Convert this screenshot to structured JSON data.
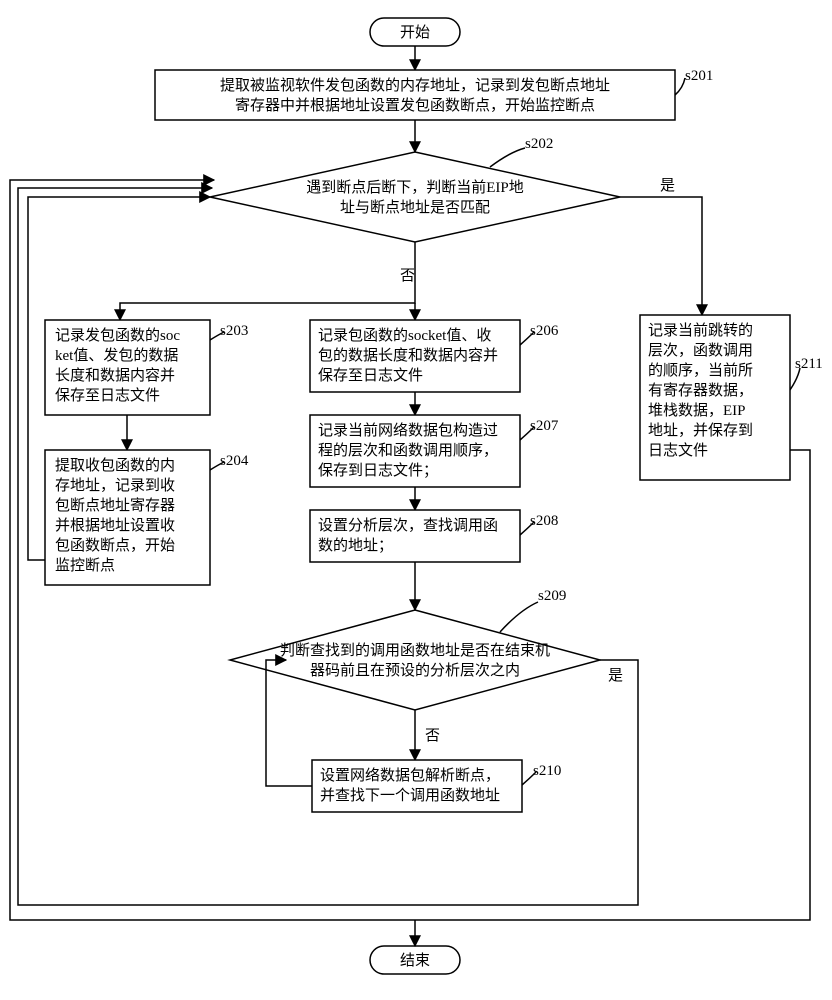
{
  "chart_data": {
    "type": "flowchart",
    "title": "",
    "nodes": [
      {
        "id": "start",
        "type": "terminator",
        "text": "开始"
      },
      {
        "id": "s201",
        "type": "process",
        "label": "s201",
        "text": "提取被监视软件发包函数的内存地址，记录到发包断点地址寄存器中并根据地址设置发包函数断点，开始监控断点"
      },
      {
        "id": "s202",
        "type": "decision",
        "label": "s202",
        "text": "遇到断点后断下，判断当前EIP地址与断点地址是否匹配"
      },
      {
        "id": "s203",
        "type": "process",
        "label": "s203",
        "text": "记录发包函数的socket值、发包的数据长度和数据内容并保存至日志文件"
      },
      {
        "id": "s204",
        "type": "process",
        "label": "s204",
        "text": "提取收包函数的内存地址，记录到收包断点地址寄存器并根据地址设置收包函数断点，开始监控断点"
      },
      {
        "id": "s206",
        "type": "process",
        "label": "s206",
        "text": "记录包函数的socket值、收包的数据长度和数据内容并保存至日志文件"
      },
      {
        "id": "s207",
        "type": "process",
        "label": "s207",
        "text": "记录当前网络数据包构造过程的层次和函数调用顺序，保存到日志文件；"
      },
      {
        "id": "s208",
        "type": "process",
        "label": "s208",
        "text": "设置分析层次，查找调用函数的地址；"
      },
      {
        "id": "s209",
        "type": "decision",
        "label": "s209",
        "text": "判断查找到的调用函数地址是否在结束机器码前且在预设的分析层次之内"
      },
      {
        "id": "s210",
        "type": "process",
        "label": "s210",
        "text": "设置网络数据包解析断点，并查找下一个调用函数地址"
      },
      {
        "id": "s211",
        "type": "process",
        "label": "s211",
        "text": "记录当前跳转的层次，函数调用的顺序，当前所有寄存器数据，堆栈数据，EIP地址，并保存到日志文件"
      },
      {
        "id": "end",
        "type": "terminator",
        "text": "结束"
      }
    ],
    "edges": [
      {
        "from": "start",
        "to": "s201",
        "label": ""
      },
      {
        "from": "s201",
        "to": "s202",
        "label": ""
      },
      {
        "from": "s202",
        "to": "s203",
        "label": "否(left)"
      },
      {
        "from": "s202",
        "to": "s206",
        "label": "否(down)"
      },
      {
        "from": "s202",
        "to": "s211",
        "label": "是"
      },
      {
        "from": "s203",
        "to": "s204",
        "label": ""
      },
      {
        "from": "s204",
        "to": "s202",
        "label": "loop"
      },
      {
        "from": "s206",
        "to": "s207",
        "label": ""
      },
      {
        "from": "s207",
        "to": "s208",
        "label": ""
      },
      {
        "from": "s208",
        "to": "s209",
        "label": ""
      },
      {
        "from": "s209",
        "to": "s210",
        "label": "否"
      },
      {
        "from": "s210",
        "to": "s209",
        "label": "loop"
      },
      {
        "from": "s209",
        "to": "s202",
        "label": "是(loop)"
      },
      {
        "from": "s211",
        "to": "s202",
        "label": "loop"
      },
      {
        "from": "flow",
        "to": "end",
        "label": ""
      }
    ]
  },
  "terminators": {
    "start": "开始",
    "end": "结束"
  },
  "labels": {
    "s201": "s201",
    "s202": "s202",
    "s203": "s203",
    "s204": "s204",
    "s206": "s206",
    "s207": "s207",
    "s208": "s208",
    "s209": "s209",
    "s210": "s210",
    "s211": "s211"
  },
  "edge_labels": {
    "yes": "是",
    "no": "否"
  },
  "s201": {
    "l1": "提取被监视软件发包函数的内存地址，记录到发包断点地址",
    "l2": "寄存器中并根据地址设置发包函数断点，开始监控断点"
  },
  "s202": {
    "l1": "遇到断点后断下，判断当前EIP地",
    "l2": "址与断点地址是否匹配"
  },
  "s203": {
    "l1": "记录发包函数的soc",
    "l2": "ket值、发包的数据",
    "l3": "长度和数据内容并",
    "l4": "保存至日志文件"
  },
  "s204": {
    "l1": "提取收包函数的内",
    "l2": "存地址，记录到收",
    "l3": "包断点地址寄存器",
    "l4": "并根据地址设置收",
    "l5": "包函数断点，开始",
    "l6": "监控断点"
  },
  "s206": {
    "l1": "记录包函数的socket值、收",
    "l2": "包的数据长度和数据内容并",
    "l3": "保存至日志文件"
  },
  "s207": {
    "l1": "记录当前网络数据包构造过",
    "l2": "程的层次和函数调用顺序，",
    "l3": "保存到日志文件；"
  },
  "s208": {
    "l1": "设置分析层次，查找调用函",
    "l2": "数的地址；"
  },
  "s209": {
    "l1": "判断查找到的调用函数地址是否在结束机",
    "l2": "器码前且在预设的分析层次之内"
  },
  "s210": {
    "l1": "设置网络数据包解析断点，",
    "l2": "并查找下一个调用函数地址"
  },
  "s211": {
    "l1": "记录当前跳转的",
    "l2": "层次，函数调用",
    "l3": "的顺序，当前所",
    "l4": "有寄存器数据，",
    "l5": "堆栈数据，EIP",
    "l6": "地址，并保存到",
    "l7": "日志文件"
  }
}
